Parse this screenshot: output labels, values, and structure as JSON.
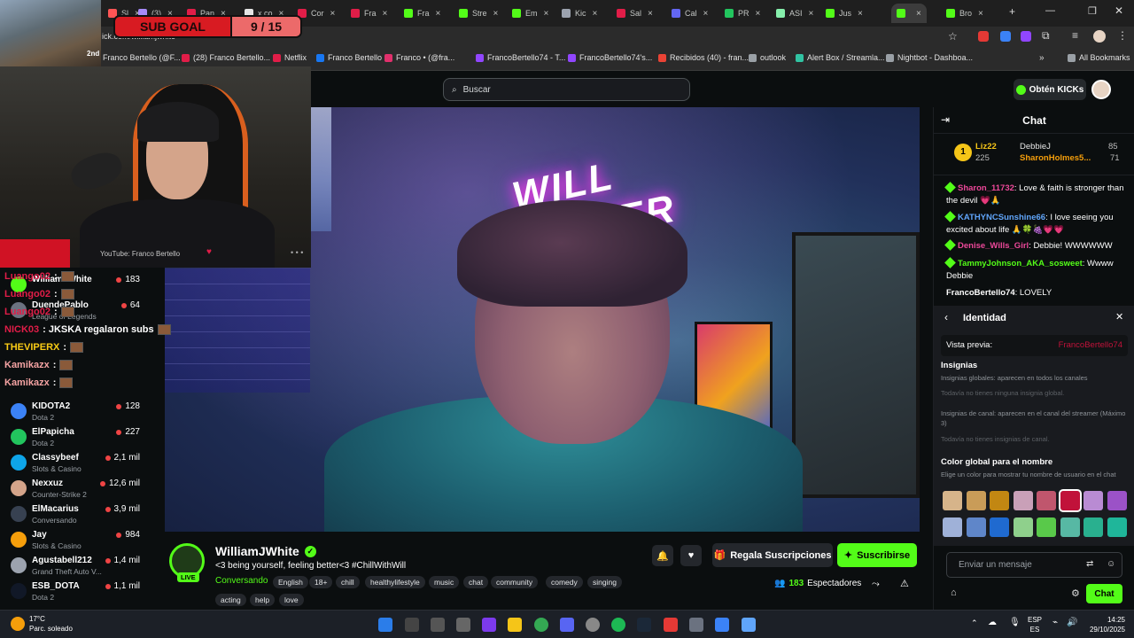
{
  "browser": {
    "tabs": [
      {
        "label": "Sl",
        "color": "#ff5555"
      },
      {
        "label": "(3)",
        "color": "#a78bfa"
      },
      {
        "label": "Pan",
        "color": "#e11d48"
      },
      {
        "label": "x.co",
        "color": "#e5e5e5"
      },
      {
        "label": "Cor",
        "color": "#e11d48"
      },
      {
        "label": "Fra",
        "color": "#e11d48"
      },
      {
        "label": "Fra",
        "color": "#53fc18"
      },
      {
        "label": "Stre",
        "color": "#53fc18"
      },
      {
        "label": "Em",
        "color": "#53fc18"
      },
      {
        "label": "Kic",
        "color": "#9ca3af"
      },
      {
        "label": "Sal",
        "color": "#e11d48"
      },
      {
        "label": "Cal",
        "color": "#6366f1"
      },
      {
        "label": "PR",
        "color": "#22c55e"
      },
      {
        "label": "ASI",
        "color": "#86efac"
      },
      {
        "label": "Jus",
        "color": "#53fc18"
      },
      {
        "label": "",
        "color": "#53fc18"
      },
      {
        "label": "Bro",
        "color": "#53fc18"
      }
    ],
    "bookmarks": [
      {
        "label": "Franco Bertello (@F...",
        "color": "#e5e5e5"
      },
      {
        "label": "(28) Franco Bertello...",
        "color": "#e11d48"
      },
      {
        "label": "Netflix",
        "color": "#e11d48"
      },
      {
        "label": "Franco Bertello",
        "color": "#1877f2"
      },
      {
        "label": "Franco • (@fra...",
        "color": "#e1306c"
      },
      {
        "label": "FrancoBertello74 - T...",
        "color": "#9146ff"
      },
      {
        "label": "FrancoBertello74's...",
        "color": "#9146ff"
      },
      {
        "label": "Recibidos (40) - fran...",
        "color": "#ea4335"
      },
      {
        "label": "outlook",
        "color": "#9aa0a6"
      },
      {
        "label": "Alert Box / Streamla...",
        "color": "#31c3a2"
      },
      {
        "label": "Nightbot - Dashboa...",
        "color": "#9aa0a6"
      }
    ],
    "all_bookmarks": "All Bookmarks",
    "url_fragment": "ick.com/williamjwhite"
  },
  "overlay": {
    "sub_goal_label": "SUB GOAL",
    "sub_goal_value": "9 / 15",
    "game_tag": "2nd",
    "youtube_label": "YouTube: Franco Bertello",
    "chat": [
      {
        "user": "Luango02",
        "text": ":",
        "color": "#e11d48"
      },
      {
        "user": "Luango02",
        "text": ":",
        "color": "#e11d48"
      },
      {
        "user": "Luango02",
        "text": ":",
        "color": "#e11d48"
      },
      {
        "user": "NICK03",
        "text": ": JKSKA regalaron subs",
        "color": "#e11d48"
      },
      {
        "user": "THEVIPERX",
        "text": ":",
        "color": "#facc15"
      },
      {
        "user": "Kamikazx",
        "text": ":",
        "color": "#f5a3a3"
      },
      {
        "user": "Kamikazx",
        "text": ":",
        "color": "#f5a3a3"
      }
    ]
  },
  "kick": {
    "search_placeholder": "Buscar",
    "get_kicks": "Obtén KICKs",
    "sidebar": [
      {
        "name": "WilliamJWhite",
        "category": "",
        "viewers": "183",
        "avatar": "#53fc18"
      },
      {
        "name": "DuendePablo",
        "category": "League of Legends",
        "viewers": "64",
        "avatar": "#6b7280"
      },
      {
        "name": "KIDOTA2",
        "category": "Dota 2",
        "viewers": "128",
        "avatar": "#3b82f6"
      },
      {
        "name": "ElPapicha",
        "category": "Dota 2",
        "viewers": "227",
        "avatar": "#22c55e"
      },
      {
        "name": "Classybeef",
        "category": "Slots & Casino",
        "viewers": "2,1 mil",
        "avatar": "#0ea5e9"
      },
      {
        "name": "Nexxuz",
        "category": "Counter-Strike 2",
        "viewers": "12,6 mil",
        "avatar": "#d4a48a"
      },
      {
        "name": "ElMacarius",
        "category": "Conversando",
        "viewers": "3,9 mil",
        "avatar": "#374151"
      },
      {
        "name": "Jay",
        "category": "Slots & Casino",
        "viewers": "984",
        "avatar": "#f59e0b"
      },
      {
        "name": "Agustabell212",
        "category": "Grand Theft Auto V...",
        "viewers": "1,4 mil",
        "avatar": "#9ca3af"
      },
      {
        "name": "ESB_DOTA",
        "category": "Dota 2",
        "viewers": "1,1 mil",
        "avatar": "#111827"
      }
    ],
    "stream": {
      "channel": "WilliamJWhite",
      "live": "LIVE",
      "title": "<3 being yourself, feeling better<3 #ChillWithWill",
      "category": "Conversando",
      "tags": [
        "English",
        "18+",
        "chill",
        "healthylifestyle",
        "music",
        "chat",
        "community",
        "comedy",
        "singing",
        "acting",
        "help",
        "love"
      ],
      "gift_label": "Regala Suscripciones",
      "subscribe_label": "Suscribirse",
      "viewers": "183",
      "viewers_label": "Espectadores",
      "neon_sign": "WILL POWER"
    },
    "chat": {
      "title": "Chat",
      "leaderboard": [
        {
          "rank": "1",
          "name": "Liz22",
          "score": "225"
        },
        {
          "name": "DebbieJ",
          "score": "85"
        },
        {
          "name": "SharonHolmes5...",
          "score": "71"
        }
      ],
      "messages": [
        {
          "user": "Sharon_11732",
          "color": "#ec4899",
          "text": ": Love & faith is stronger than the devil 💗🙏"
        },
        {
          "user": "KATHYNCSunshine66",
          "color": "#60a5fa",
          "text": ": I love seeing you excited about life 🙏🍀🍇💗💗"
        },
        {
          "user": "Denise_Wills_Girl",
          "color": "#ec4899",
          "text": ": Debbie! WWWWWW"
        },
        {
          "user": "TammyJohnson_AKA_sosweet",
          "color": "#53fc18",
          "text": ": Wwww Debbie"
        },
        {
          "user": "FrancoBertello74",
          "color": "#ffffff",
          "text": ": LOVELY"
        }
      ],
      "identity": {
        "title": "Identidad",
        "preview_label": "Vista previa:",
        "preview_name": "FrancoBertello74",
        "badges_title": "Insignias",
        "global_badges": "Insignias globales: aparecen en todos los canales",
        "no_global": "Todavía no tienes ninguna insignia global.",
        "channel_badges": "Insignias de canal: aparecen en el canal del streamer (Máximo 3)",
        "no_channel": "Todavía no tienes insignias de canal.",
        "color_title": "Color global para el nombre",
        "color_desc": "Elige un color para mostrar tu nombre de usuario en el chat",
        "swatches": [
          "#d6b48a",
          "#c99c58",
          "#c28712",
          "#c9a0b8",
          "#c0566d",
          "#c1123a",
          "#b98bd3",
          "#9b52c7",
          "#9fb1d8",
          "#5f86c9",
          "#1f6ad0",
          "#8fd08c",
          "#59c94a",
          "#57b8a4",
          "#29b08f",
          "#1fb69a"
        ]
      },
      "input_placeholder": "Enviar un mensaje",
      "send_label": "Chat"
    }
  },
  "taskbar": {
    "weather_temp": "17°C",
    "weather_desc": "Parc. soleado",
    "lang": "ESP",
    "lang_sub": "ES",
    "time": "14:25",
    "date": "29/10/2025"
  }
}
